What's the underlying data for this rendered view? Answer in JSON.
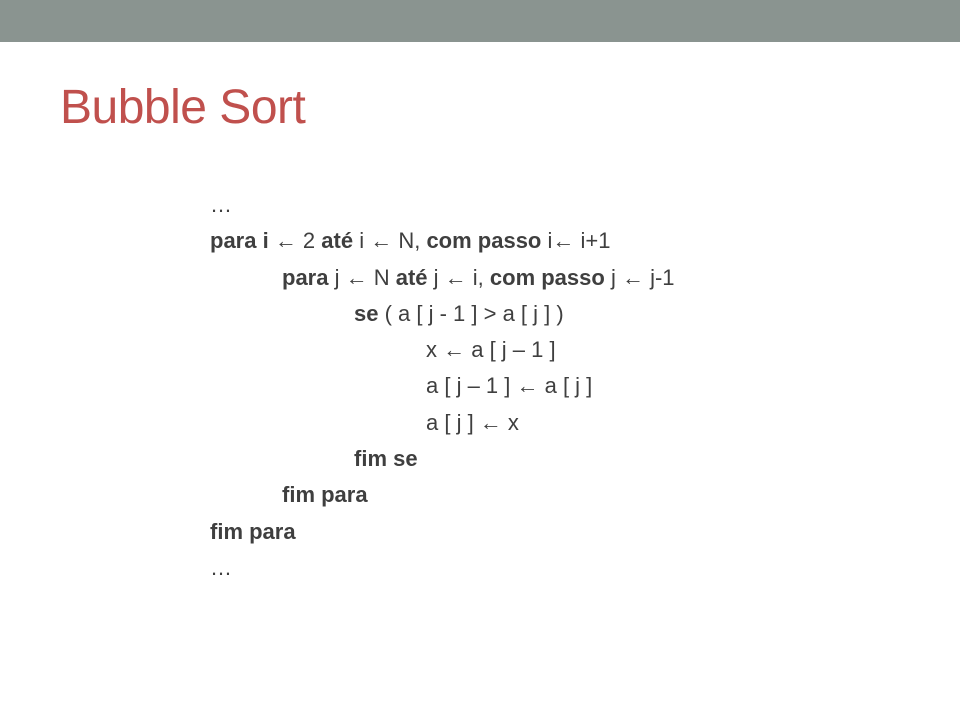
{
  "title": "Bubble Sort",
  "code": {
    "l0": "…",
    "l1a": "para i ",
    "l1b": " 2 ",
    "l1c": "até",
    "l1d": " i ",
    "l1e": " N, ",
    "l1f": "com passo",
    "l1g": " i",
    "l1h": " i+1",
    "l2a": "para",
    "l2b": " j ",
    "l2c": " N ",
    "l2d": "até",
    "l2e": " j ",
    "l2f": " i, ",
    "l2g": "com passo",
    "l2h": " j ",
    "l2i": " j-1",
    "l3a": "se",
    "l3b": " ( a [ j - 1 ] > a [ j ] )",
    "l4": "x ← a [ j – 1 ]",
    "l5": "a [ j – 1 ] ← a [ j ]",
    "l6": "a [ j ] ← x",
    "l7": "fim se",
    "l8": "fim para",
    "l9": "fim para",
    "l10": "…"
  },
  "arrow": "←"
}
